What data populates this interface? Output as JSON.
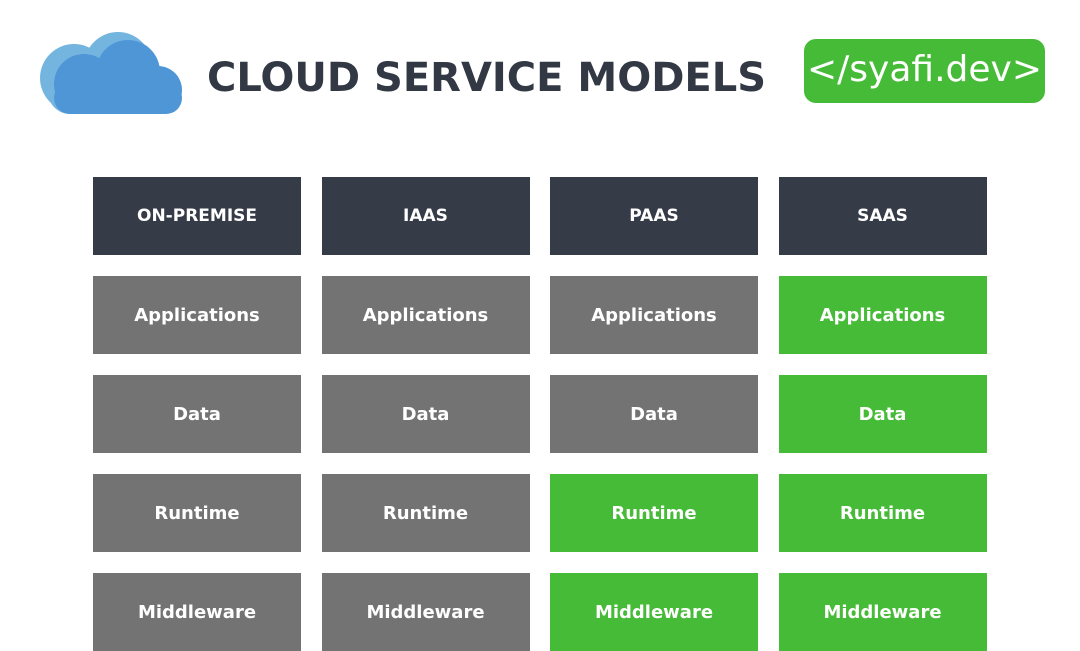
{
  "title": "CLOUD SERVICE MODELS",
  "brand_badge": "</syafi.dev>",
  "icons": {
    "logo": "cloud-icon"
  },
  "colors": {
    "title": "#323844",
    "header_bg": "#363b48",
    "self_managed_bg": "#737373",
    "provider_managed_bg": "#46bb37",
    "badge_bg": "#46bb37",
    "cloud_front": "#4f96d6",
    "cloud_back": "#74b5e0"
  },
  "columns": [
    {
      "label": "ON-PREMISE",
      "rows": [
        {
          "label": "Applications",
          "provided": false
        },
        {
          "label": "Data",
          "provided": false
        },
        {
          "label": "Runtime",
          "provided": false
        },
        {
          "label": "Middleware",
          "provided": false
        }
      ]
    },
    {
      "label": "IAAS",
      "rows": [
        {
          "label": "Applications",
          "provided": false
        },
        {
          "label": "Data",
          "provided": false
        },
        {
          "label": "Runtime",
          "provided": false
        },
        {
          "label": "Middleware",
          "provided": false
        }
      ]
    },
    {
      "label": "PAAS",
      "rows": [
        {
          "label": "Applications",
          "provided": false
        },
        {
          "label": "Data",
          "provided": false
        },
        {
          "label": "Runtime",
          "provided": true
        },
        {
          "label": "Middleware",
          "provided": true
        }
      ]
    },
    {
      "label": "SAAS",
      "rows": [
        {
          "label": "Applications",
          "provided": true
        },
        {
          "label": "Data",
          "provided": true
        },
        {
          "label": "Runtime",
          "provided": true
        },
        {
          "label": "Middleware",
          "provided": true
        }
      ]
    }
  ]
}
